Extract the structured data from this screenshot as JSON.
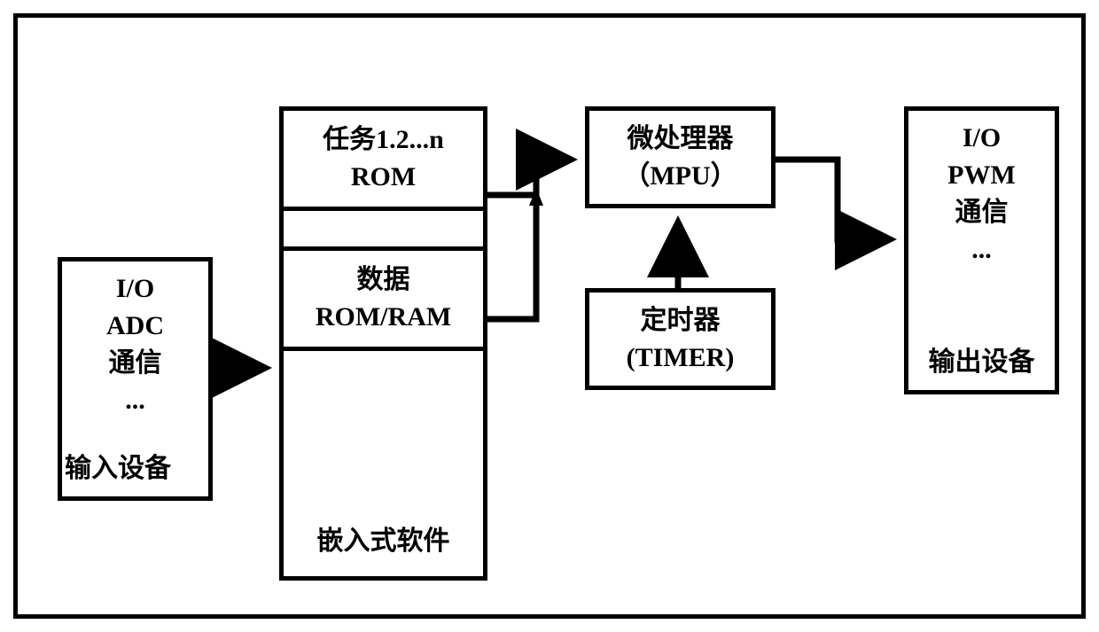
{
  "input": {
    "line1": "I/O",
    "line2": "ADC",
    "line3": "通信",
    "line4": "...",
    "label": "输入设备"
  },
  "software": {
    "top_line1": "任务1.2...n",
    "top_line2": "ROM",
    "mid_line1": "数据",
    "mid_line2": "ROM/RAM",
    "label": "嵌入式软件"
  },
  "mpu": {
    "line1": "微处理器",
    "line2": "（MPU）"
  },
  "timer": {
    "line1": "定时器",
    "line2": "(TIMER)"
  },
  "output": {
    "line1": "I/O",
    "line2": "PWM",
    "line3": "通信",
    "line4": "...",
    "label": "输出设备"
  }
}
